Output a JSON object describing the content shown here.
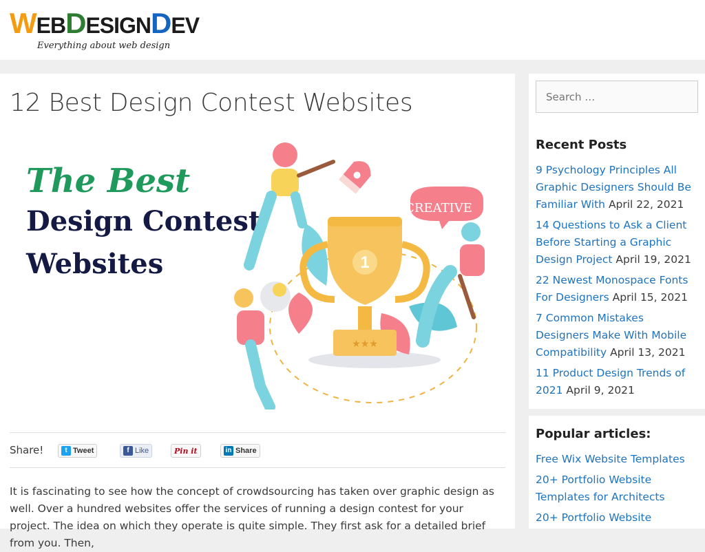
{
  "header": {
    "logo_w": "W",
    "logo_eb": "EB",
    "logo_d1": "D",
    "logo_esign": "ESIGN",
    "logo_d2": "D",
    "logo_ev": "EV",
    "tagline": "Everything about web design"
  },
  "post": {
    "title": "12 Best Design Contest Websites",
    "hero_script": "The Best",
    "hero_line1": "Design Contest",
    "hero_line2": "Websites",
    "hero_bubble": "CREATIVE",
    "hero_trophy_number": "1",
    "share_label": "Share!",
    "share_buttons": {
      "tweet": "Tweet",
      "like": "Like",
      "pinit": "Pin it",
      "share": "Share"
    },
    "body": "It is fascinating to see how the concept of crowdsourcing has taken over graphic design as well. Over a hundred websites offer the services of running a design contest for your project. The idea on which they operate is quite simple. They first ask for a detailed brief from you. Then,"
  },
  "sidebar": {
    "search_placeholder": "Search …",
    "recent_title": "Recent Posts",
    "recent_posts": [
      {
        "title": "9 Psychology Principles All Graphic Designers Should Be Familiar With",
        "date": "April 22, 2021"
      },
      {
        "title": "14 Questions to Ask a Client Before Starting a Graphic Design Project",
        "date": "April 19, 2021"
      },
      {
        "title": "22 Newest Monospace Fonts For Designers",
        "date": "April 15, 2021"
      },
      {
        "title": "7 Common Mistakes Designers Make With Mobile Compatibility",
        "date": "April 13, 2021"
      },
      {
        "title": "11 Product Design Trends of 2021",
        "date": "April 9, 2021"
      }
    ],
    "popular_title": "Popular articles:",
    "popular_posts": [
      {
        "title": "Free Wix Website Templates"
      },
      {
        "title": "20+ Portfolio Website Templates for Architects"
      },
      {
        "title": "20+ Portfolio Website"
      }
    ]
  },
  "colors": {
    "link": "#1e73be",
    "logo_orange": "#f39c12",
    "logo_green": "#2e7d32",
    "logo_blue": "#1565c0",
    "hero_green": "#1f9a5c",
    "hero_navy": "#141a44",
    "page_bg": "#efefef"
  }
}
